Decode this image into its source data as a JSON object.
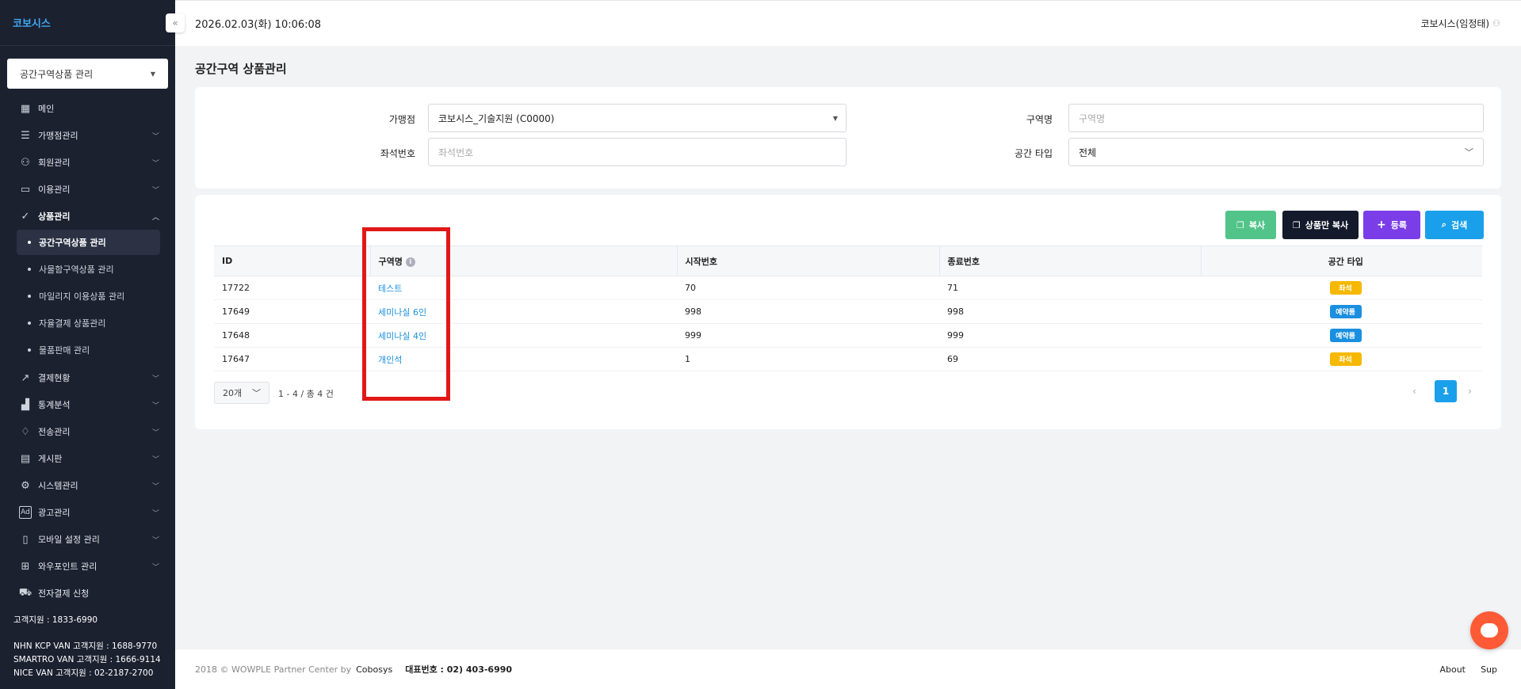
{
  "sidebar": {
    "brand": "코보시스",
    "collapse_icon": "«",
    "menu_select": "공간구역상품 관리",
    "items": [
      {
        "label": "메인",
        "icon": "grid-icon"
      },
      {
        "label": "가맹점관리",
        "icon": "list-icon"
      },
      {
        "label": "회원관리",
        "icon": "users-icon"
      },
      {
        "label": "이용관리",
        "icon": "monitor-icon"
      },
      {
        "label": "상품관리",
        "icon": "bag-icon"
      }
    ],
    "sub_items": [
      {
        "label": "공간구역상품 관리"
      },
      {
        "label": "사물함구역상품 관리"
      },
      {
        "label": "마일리지 이용상품 관리"
      },
      {
        "label": "자율결제 상품관리"
      },
      {
        "label": "물품판매 관리"
      }
    ],
    "items2": [
      {
        "label": "결제현황",
        "icon": "chart-line-icon"
      },
      {
        "label": "통계분석",
        "icon": "bar-chart-icon"
      },
      {
        "label": "전송관리",
        "icon": "bell-icon"
      },
      {
        "label": "게시판",
        "icon": "board-icon"
      },
      {
        "label": "시스템관리",
        "icon": "gear-icon"
      },
      {
        "label": "광고관리",
        "icon": "ad-icon"
      },
      {
        "label": "모바일 설정 관리",
        "icon": "mobile-icon"
      },
      {
        "label": "와우포인트 관리",
        "icon": "gift-icon"
      },
      {
        "label": "전자결제 신청",
        "icon": "cart-icon"
      }
    ],
    "support": {
      "main": "고객지원 : 1833-6990",
      "nhn": "NHN KCP VAN 고객지원 : 1688-9770",
      "smartro": "SMARTRO VAN 고객지원 : 1666-9114",
      "nice": "NICE VAN 고객지원 : 02-2187-2700"
    }
  },
  "header": {
    "datetime": "2026.02.03(화) 10:06:08",
    "user": "코보시스(임정태)"
  },
  "page": {
    "title": "공간구역 상품관리"
  },
  "filters": {
    "store_label": "가맹점",
    "store_value": "코보시스_기술지원 (C0000)",
    "zone_label": "구역명",
    "zone_placeholder": "구역명",
    "seat_label": "좌석번호",
    "seat_placeholder": "좌석번호",
    "type_label": "공간 타입",
    "type_value": "전체"
  },
  "toolbar": {
    "copy": "복사",
    "product_copy": "상품만 복사",
    "register": "등록",
    "search": "검색"
  },
  "table": {
    "headers": [
      "ID",
      "구역명",
      "시작번호",
      "종료번호",
      "공간 타입"
    ],
    "rows": [
      {
        "id": "17722",
        "name": "테스트",
        "start": "70",
        "end": "71",
        "type": "좌석"
      },
      {
        "id": "17649",
        "name": "세미나실 6인",
        "start": "998",
        "end": "998",
        "type": "예약룸"
      },
      {
        "id": "17648",
        "name": "세미나실 4인",
        "start": "999",
        "end": "999",
        "type": "예약룸"
      },
      {
        "id": "17647",
        "name": "개인석",
        "start": "1",
        "end": "69",
        "type": "좌석"
      }
    ]
  },
  "pagination": {
    "page_size": "20개",
    "count": "1 - 4 / 총 4 건",
    "current": "1"
  },
  "footer": {
    "copyright": "2018 © WOWPLE Partner Center by",
    "brand": "Cobosys",
    "tel": "대표번호 : 02) 403-6990",
    "about": "About",
    "support": "Sup"
  },
  "colors": {
    "sidebar_bg": "#1c2130",
    "accent_blue": "#1aa0ea",
    "copy_green": "#52c48a",
    "register_purple": "#7a3de8",
    "seat_badge": "#f6b800",
    "reserve_badge": "#1a8fe0",
    "highlight_red": "#e01818"
  }
}
